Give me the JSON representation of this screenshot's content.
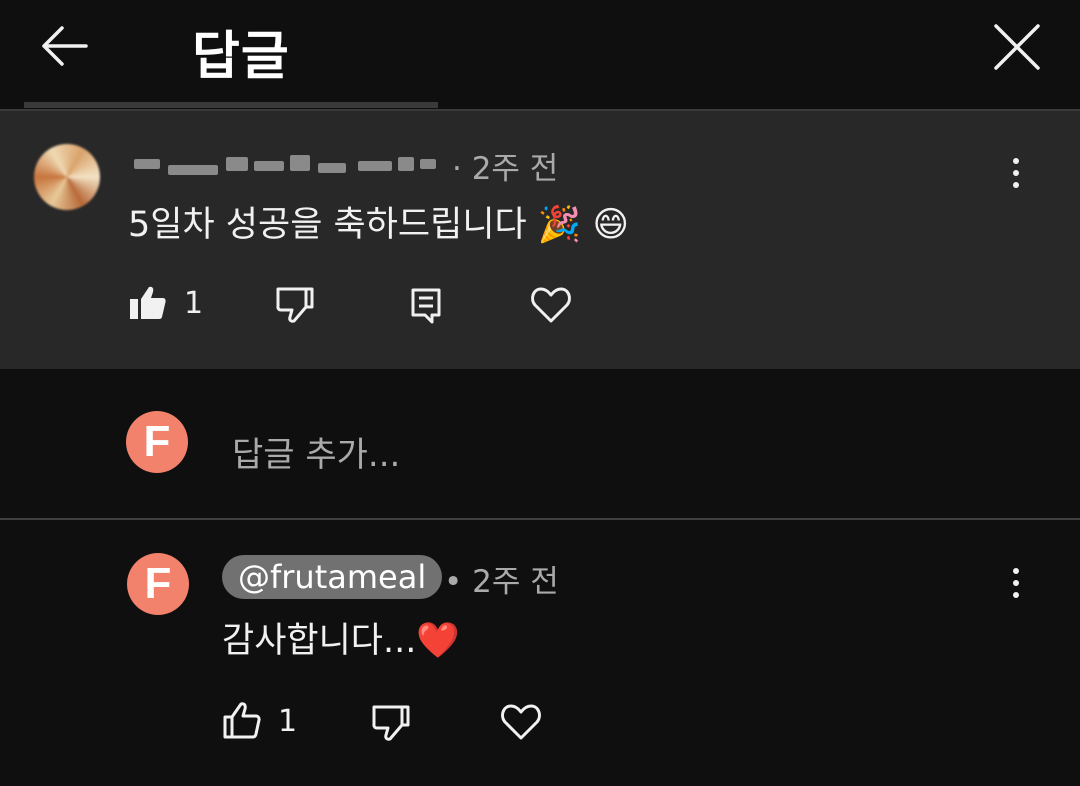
{
  "header": {
    "title": "답글",
    "back_icon": "arrow-left-icon",
    "close_icon": "close-icon"
  },
  "parent_comment": {
    "time": "· 2주 전",
    "text": "5일차 성공을 축하드립니다 🎉 😄",
    "likes": "1"
  },
  "reply_input": {
    "avatar_letter": "F",
    "placeholder": "답글 추가..."
  },
  "reply": {
    "avatar_letter": "F",
    "handle": "@frutameal",
    "time": "• 2주 전",
    "text": "감사합니다...❤️",
    "likes": "1"
  },
  "colors": {
    "background": "#0f0f0f",
    "highlight": "#282828",
    "avatar": "#f2826c",
    "secondary_text": "#aaaaaa"
  }
}
